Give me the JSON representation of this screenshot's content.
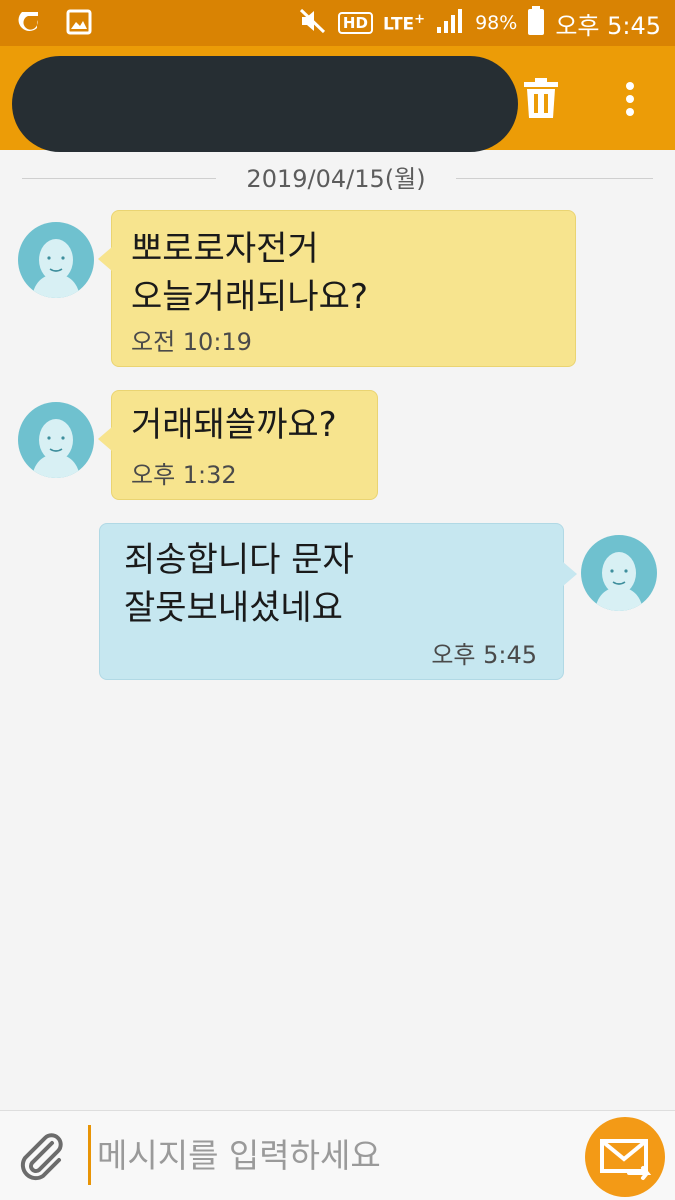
{
  "status_bar": {
    "lte_label": "LTE",
    "lte_plus": "+",
    "hd_label": "HD",
    "battery_percent": "98%",
    "time": "오후 5:45"
  },
  "conversation": {
    "date": "2019/04/15(월)"
  },
  "messages": [
    {
      "direction": "incoming",
      "text": "뽀로로자전거\n오늘거래되나요?",
      "time": "오전 10:19"
    },
    {
      "direction": "incoming",
      "text": "거래돼쓸까요?",
      "time": "오후 1:32"
    },
    {
      "direction": "outgoing",
      "text": "죄송합니다 문자\n잘못보내셨네요",
      "time": "오후 5:45"
    }
  ],
  "composer": {
    "placeholder": "메시지를 입력하세요"
  },
  "colors": {
    "status_bar": "#d98303",
    "app_bar": "#ec9c07",
    "incoming_bubble": "#f7e48e",
    "outgoing_bubble": "#c6e7f0",
    "avatar": "#6fc1cf",
    "send_button": "#f39a16"
  },
  "icons": {
    "status_left": [
      "opera-icon",
      "gallery-icon"
    ],
    "status_right": [
      "mute-icon",
      "hd-voice-icon",
      "lte-icon",
      "signal-icon",
      "battery-icon"
    ],
    "app_bar": [
      "trash-icon",
      "more-vert-icon"
    ],
    "composer": [
      "paperclip-icon",
      "send-message-icon"
    ]
  }
}
